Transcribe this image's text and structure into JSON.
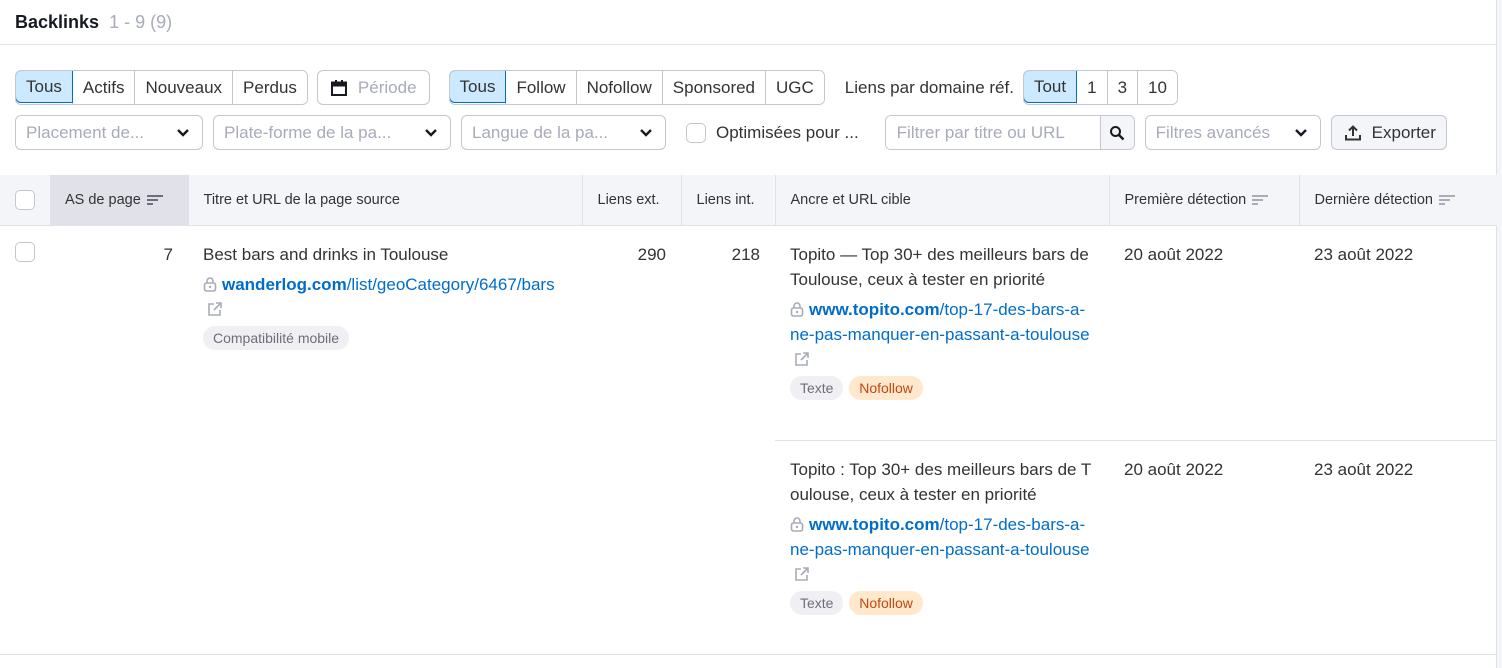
{
  "header": {
    "title": "Backlinks",
    "count": "1 - 9 (9)"
  },
  "filters": {
    "status_tabs": [
      {
        "label": "Tous",
        "active": true
      },
      {
        "label": "Actifs",
        "active": false
      },
      {
        "label": "Nouveaux",
        "active": false
      },
      {
        "label": "Perdus",
        "active": false
      }
    ],
    "period_label": "Période",
    "link_type_tabs": [
      {
        "label": "Tous",
        "active": true
      },
      {
        "label": "Follow",
        "active": false
      },
      {
        "label": "Nofollow",
        "active": false
      },
      {
        "label": "Sponsored",
        "active": false
      },
      {
        "label": "UGC",
        "active": false
      }
    ],
    "links_per_domain_label": "Liens par domaine réf.",
    "links_per_domain_tabs": [
      {
        "label": "Tout",
        "active": true
      },
      {
        "label": "1",
        "active": false
      },
      {
        "label": "3",
        "active": false
      },
      {
        "label": "10",
        "active": false
      }
    ],
    "placement_select": "Placement de...",
    "platform_select": "Plate-forme de la pa...",
    "language_select": "Langue de la pa...",
    "optimized_checkbox_label": "Optimisées pour ...",
    "search_placeholder": "Filtrer par titre ou URL",
    "advanced_filters": "Filtres avancés",
    "export_label": "Exporter"
  },
  "table": {
    "columns": [
      "AS de page",
      "Titre et URL de la page source",
      "Liens ext.",
      "Liens int.",
      "Ancre et URL cible",
      "Première détection",
      "Dernière détection"
    ],
    "rows": [
      {
        "page_as": "7",
        "source_title": "Best bars and drinks in Toulouse",
        "source_url_host": "wanderlog.com",
        "source_url_path": "/list/geoCategory/6467/bars",
        "source_badge": "Compatibilité mobile",
        "ext_links": "290",
        "int_links": "218",
        "targets": [
          {
            "anchor": "Topito — Top 30+ des meilleurs bars de Toulouse, ceux à tester en priorité",
            "url_host": "www.topito.com",
            "url_path": "/top-17-des-bars-a-ne-pas-manquer-en-passant-a-toulouse",
            "badges": [
              "Texte",
              "Nofollow"
            ],
            "first_seen": "20 août 2022",
            "last_seen": "23 août 2022"
          },
          {
            "anchor": "Topito : Top 30+ des meilleurs bars de Toulouse, ceux à tester en priorité",
            "url_host": "www.topito.com",
            "url_path": "/top-17-des-bars-a-ne-pas-manquer-en-passant-a-toulouse",
            "badges": [
              "Texte",
              "Nofollow"
            ],
            "first_seen": "20 août 2022",
            "last_seen": "23 août 2022"
          }
        ]
      }
    ]
  },
  "colors": {
    "accent": "#006dca",
    "active_bg": "#cce9ff",
    "nofollow_bg": "#ffe8cc",
    "nofollow_text": "#c4470e"
  }
}
